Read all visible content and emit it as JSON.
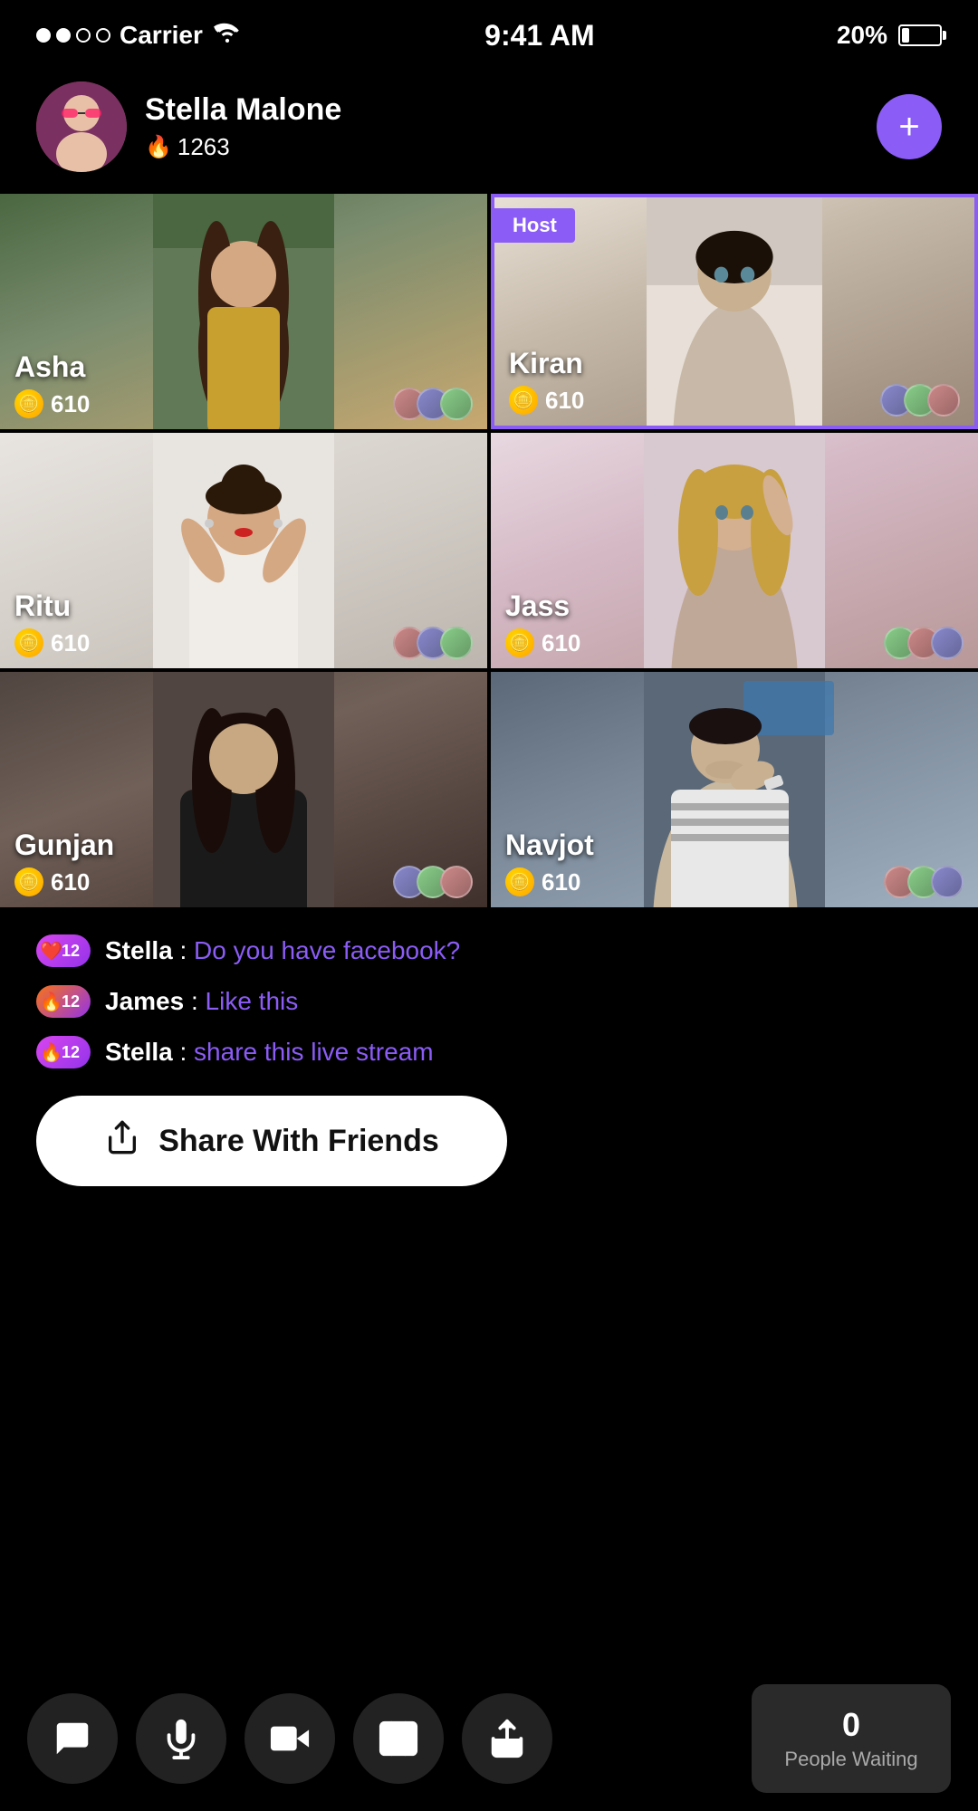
{
  "statusBar": {
    "carrier": "Carrier",
    "time": "9:41 AM",
    "battery": "20%"
  },
  "userHeader": {
    "name": "Stella Malone",
    "fireCount": "1263",
    "addLabel": "+"
  },
  "grid": {
    "cells": [
      {
        "id": "asha",
        "name": "Asha",
        "coins": "610",
        "isHost": false,
        "bgClass": "bg-asha"
      },
      {
        "id": "kiran",
        "name": "Kiran",
        "coins": "610",
        "isHost": true,
        "bgClass": "bg-kiran"
      },
      {
        "id": "ritu",
        "name": "Ritu",
        "coins": "610",
        "isHost": false,
        "bgClass": "bg-ritu"
      },
      {
        "id": "jass",
        "name": "Jass",
        "coins": "610",
        "isHost": false,
        "bgClass": "bg-jass"
      },
      {
        "id": "gunjan",
        "name": "Gunjan",
        "coins": "610",
        "isHost": false,
        "bgClass": "bg-gunjan"
      },
      {
        "id": "navjot",
        "name": "Navjot",
        "coins": "610",
        "isHost": false,
        "bgClass": "bg-navjot"
      }
    ],
    "hostLabel": "Host"
  },
  "chat": {
    "messages": [
      {
        "user": "Stella",
        "text": "Do you have facebook?",
        "badgeType": "pink",
        "badgeEmoji": "❤️",
        "badgeNum": "12"
      },
      {
        "user": "James",
        "text": "Like this",
        "badgeType": "orange",
        "badgeEmoji": "🔥",
        "badgeNum": "12"
      },
      {
        "user": "Stella",
        "text": "share this live stream",
        "badgeType": "pink",
        "badgeEmoji": "🔥",
        "badgeNum": "12"
      }
    ]
  },
  "shareButton": {
    "label": "Share With Friends"
  },
  "bottomBar": {
    "peopleWaiting": {
      "count": "0",
      "label": "People Waiting"
    }
  }
}
